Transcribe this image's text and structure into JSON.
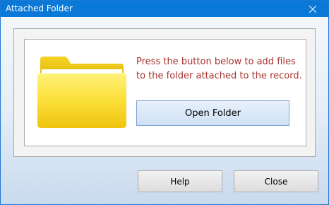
{
  "window": {
    "title": "Attached Folder"
  },
  "content": {
    "message": "Press the button below to add files to the folder attached to the record.",
    "open_folder_label": "Open Folder"
  },
  "footer": {
    "help_label": "Help",
    "close_label": "Close"
  },
  "icons": {
    "folder": "folder-icon",
    "title_close": "close-icon"
  },
  "colors": {
    "title_bar": "#0a78d7",
    "message_text": "#a8332f",
    "folder_yellow": "#f7d21c"
  }
}
